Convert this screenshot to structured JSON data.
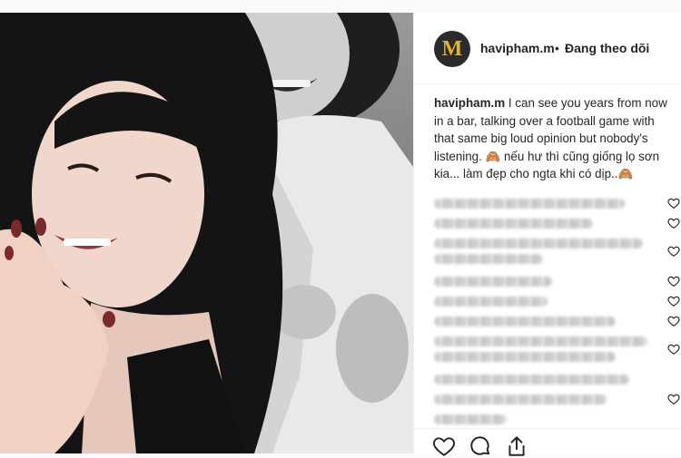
{
  "post": {
    "username": "havipham.m",
    "dot": "•",
    "follow_status": "Đang theo dõi",
    "caption_user": "havipham.m",
    "caption_text": " I can see you years from now in a bar, talking over a football game with that same big loud opinion but nobody's listening. 🙈 nếu hư thì cũng giống lọ sơn kia... làm đẹp cho ngta khi có dịp..🙈"
  },
  "avatar": {
    "letter": "M",
    "accent": "#e3b32e"
  },
  "comments_blurred_count": 11,
  "icons": {
    "actions": [
      "heart-icon",
      "comment-icon",
      "share-icon"
    ],
    "comment_like": "heart-icon"
  }
}
